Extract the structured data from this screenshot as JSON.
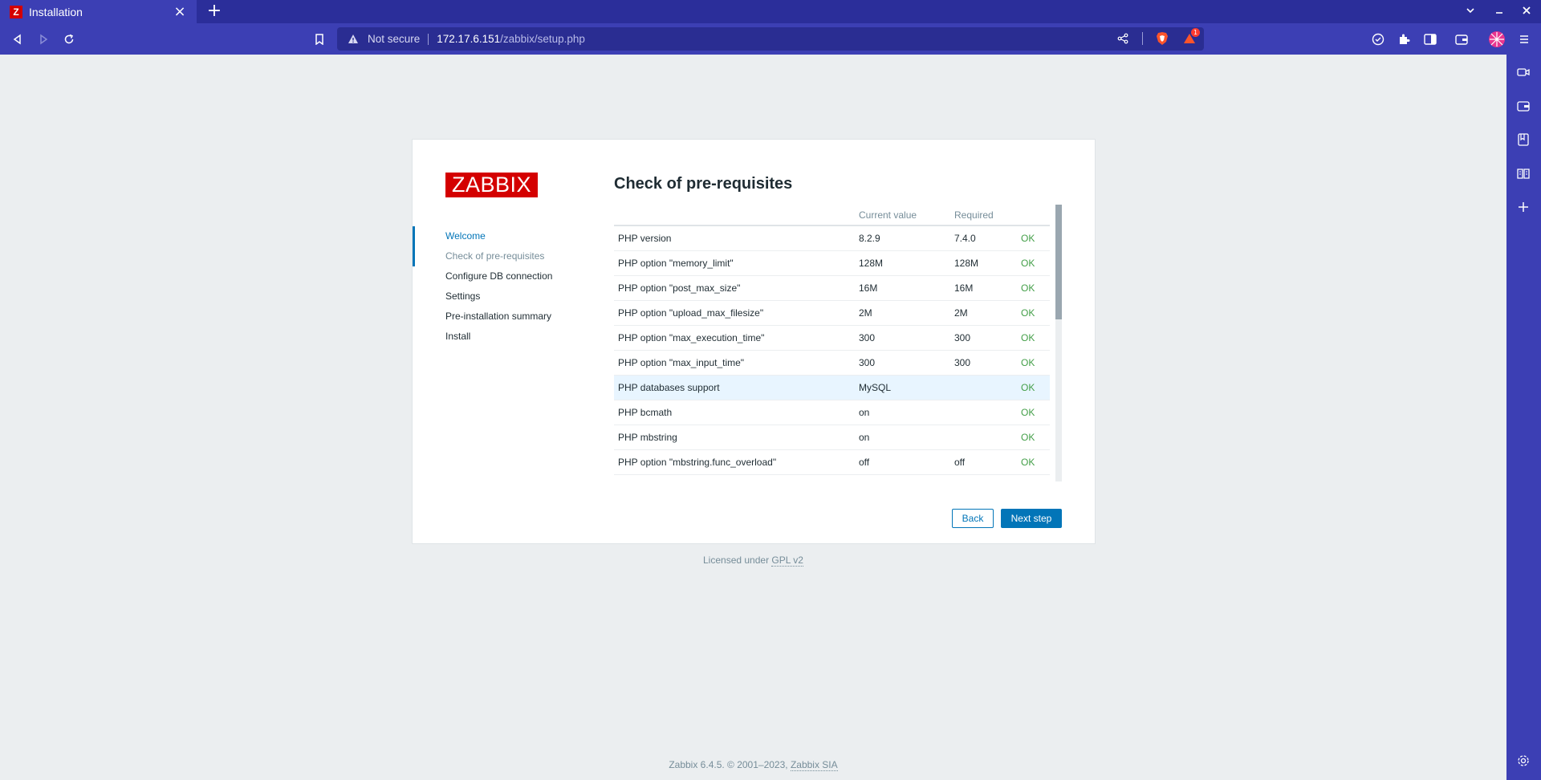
{
  "browser": {
    "tab": {
      "title": "Installation",
      "favicon_letter": "Z"
    },
    "url": {
      "security_label": "Not secure",
      "host": "172.17.6.151",
      "path": "/zabbix/setup.php"
    },
    "rewards_badge": "1",
    "icons": {
      "tab_close": "close-icon",
      "new_tab": "plus-icon",
      "back": "back-arrow-icon",
      "forward": "forward-arrow-icon",
      "reload": "reload-icon",
      "bookmark": "bookmark-icon",
      "warning": "warning-triangle-icon",
      "share": "share-icon",
      "shields": "brave-shields-icon",
      "rewards": "brave-rewards-icon"
    }
  },
  "setup": {
    "logo": "ZABBIX",
    "title": "Check of pre-requisites",
    "steps": [
      {
        "label": "Welcome",
        "state": "done"
      },
      {
        "label": "Check of pre-requisites",
        "state": "current"
      },
      {
        "label": "Configure DB connection",
        "state": "pending"
      },
      {
        "label": "Settings",
        "state": "pending"
      },
      {
        "label": "Pre-installation summary",
        "state": "pending"
      },
      {
        "label": "Install",
        "state": "pending"
      }
    ],
    "table": {
      "headers": [
        "",
        "Current value",
        "Required",
        ""
      ],
      "rows": [
        {
          "name": "PHP version",
          "current": "8.2.9",
          "required": "7.4.0",
          "result": "OK"
        },
        {
          "name": "PHP option \"memory_limit\"",
          "current": "128M",
          "required": "128M",
          "result": "OK"
        },
        {
          "name": "PHP option \"post_max_size\"",
          "current": "16M",
          "required": "16M",
          "result": "OK"
        },
        {
          "name": "PHP option \"upload_max_filesize\"",
          "current": "2M",
          "required": "2M",
          "result": "OK"
        },
        {
          "name": "PHP option \"max_execution_time\"",
          "current": "300",
          "required": "300",
          "result": "OK"
        },
        {
          "name": "PHP option \"max_input_time\"",
          "current": "300",
          "required": "300",
          "result": "OK"
        },
        {
          "name": "PHP databases support",
          "current": "MySQL",
          "required": "",
          "result": "OK"
        },
        {
          "name": "PHP bcmath",
          "current": "on",
          "required": "",
          "result": "OK"
        },
        {
          "name": "PHP mbstring",
          "current": "on",
          "required": "",
          "result": "OK"
        },
        {
          "name": "PHP option \"mbstring.func_overload\"",
          "current": "off",
          "required": "off",
          "result": "OK"
        }
      ]
    },
    "buttons": {
      "back": "Back",
      "next": "Next step"
    },
    "license": {
      "prefix": "Licensed under ",
      "link": "GPL v2"
    },
    "footer": {
      "prefix": "Zabbix 6.4.5. © 2001–2023, ",
      "link": "Zabbix SIA"
    }
  },
  "colors": {
    "brand_red": "#d40000",
    "accent_blue": "#0275b8",
    "ok_green": "#429e47",
    "browser_chrome": "#3c3fb4"
  }
}
